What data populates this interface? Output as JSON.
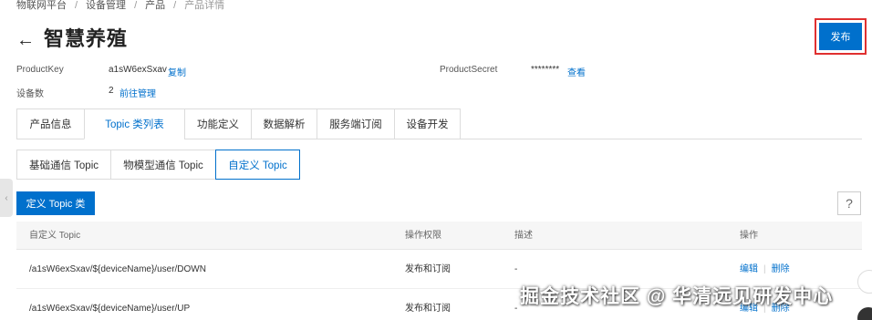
{
  "breadcrumb": {
    "items": [
      "物联网平台",
      "设备管理",
      "产品",
      "产品详情"
    ],
    "separator": "/"
  },
  "header": {
    "back_icon": "←",
    "title": "智慧养殖",
    "publish_label": "发布"
  },
  "meta": {
    "product_key_label": "ProductKey",
    "product_key_value": "a1sW6exSxav",
    "copy_label": "复制",
    "product_secret_label": "ProductSecret",
    "product_secret_value": "********",
    "view_label": "查看",
    "device_count_label": "设备数",
    "device_count_value": "2",
    "manage_label": "前往管理"
  },
  "tabs": [
    {
      "label": "产品信息",
      "active": false
    },
    {
      "label": "Topic 类列表",
      "active": true
    },
    {
      "label": "功能定义",
      "active": false
    },
    {
      "label": "数据解析",
      "active": false
    },
    {
      "label": "服务端订阅",
      "active": false
    },
    {
      "label": "设备开发",
      "active": false
    }
  ],
  "subtabs": [
    {
      "label": "基础通信 Topic",
      "active": false
    },
    {
      "label": "物模型通信 Topic",
      "active": false
    },
    {
      "label": "自定义 Topic",
      "active": true
    }
  ],
  "toolbar": {
    "define_label": "定义 Topic 类",
    "help_icon": "?"
  },
  "table": {
    "headers": [
      "自定义 Topic",
      "操作权限",
      "描述",
      "操作"
    ],
    "rows": [
      {
        "topic": "/a1sW6exSxav/${deviceName}/user/DOWN",
        "permission": "发布和订阅",
        "description": "-",
        "edit": "编辑",
        "delete": "删除"
      },
      {
        "topic": "/a1sW6exSxav/${deviceName}/user/UP",
        "permission": "发布和订阅",
        "description": "-",
        "edit": "编辑",
        "delete": "删除"
      }
    ]
  },
  "watermark": "掘金技术社区 @ 华清远见研发中心",
  "colors": {
    "accent": "#0070cc",
    "highlight_border": "#e03030"
  }
}
